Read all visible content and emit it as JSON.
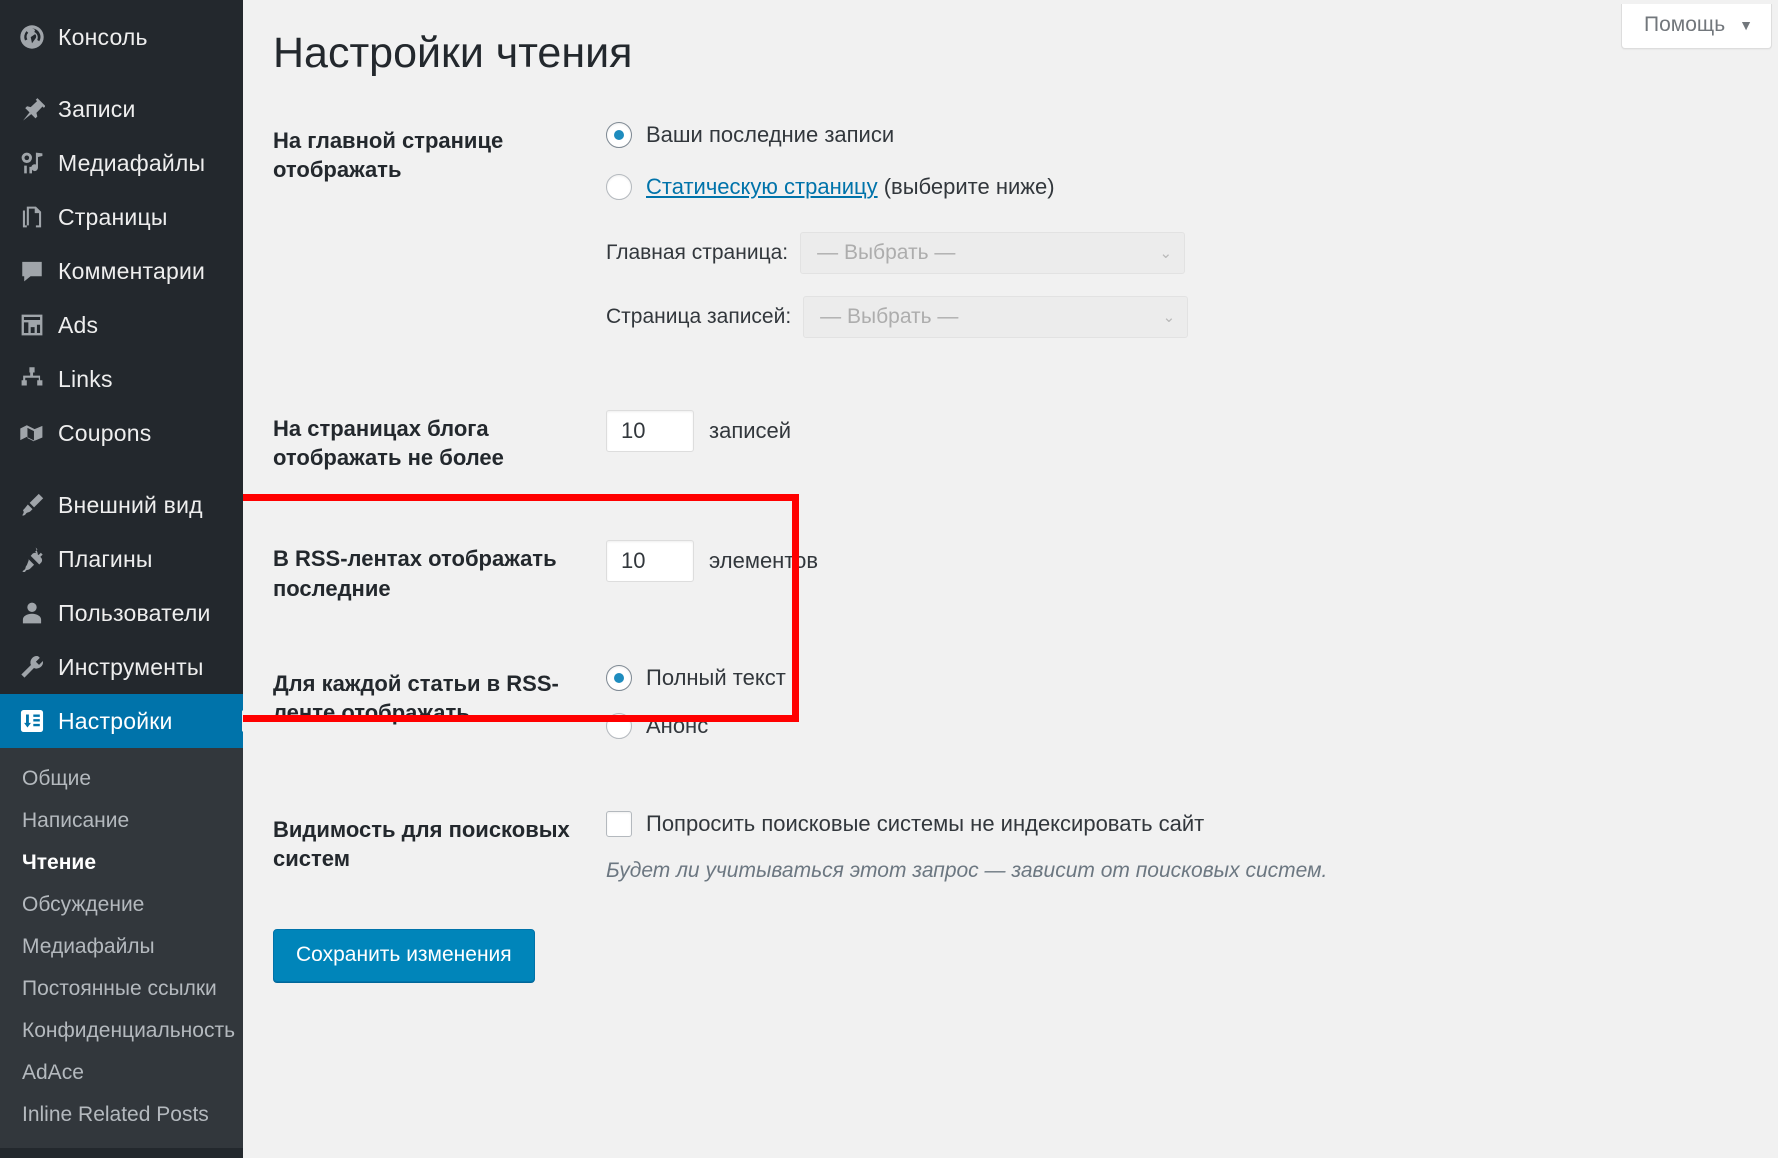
{
  "sidebar": {
    "items": [
      {
        "label": "Консоль",
        "icon": "dashboard-icon",
        "current": false,
        "gap": false
      },
      {
        "label": "Записи",
        "icon": "pin-icon",
        "current": false,
        "gap": true
      },
      {
        "label": "Медиафайлы",
        "icon": "media-icon",
        "current": false,
        "gap": false
      },
      {
        "label": "Страницы",
        "icon": "pages-icon",
        "current": false,
        "gap": false
      },
      {
        "label": "Комментарии",
        "icon": "comments-icon",
        "current": false,
        "gap": false
      },
      {
        "label": "Ads",
        "icon": "ads-icon",
        "current": false,
        "gap": false
      },
      {
        "label": "Links",
        "icon": "links-icon",
        "current": false,
        "gap": false
      },
      {
        "label": "Coupons",
        "icon": "coupons-icon",
        "current": false,
        "gap": false
      },
      {
        "label": "Внешний вид",
        "icon": "appearance-icon",
        "current": false,
        "gap": true
      },
      {
        "label": "Плагины",
        "icon": "plugins-icon",
        "current": false,
        "gap": false
      },
      {
        "label": "Пользователи",
        "icon": "users-icon",
        "current": false,
        "gap": false
      },
      {
        "label": "Инструменты",
        "icon": "tools-icon",
        "current": false,
        "gap": false
      },
      {
        "label": "Настройки",
        "icon": "settings-icon",
        "current": true,
        "gap": false
      }
    ],
    "submenu": [
      {
        "label": "Общие",
        "active": false
      },
      {
        "label": "Написание",
        "active": false
      },
      {
        "label": "Чтение",
        "active": true
      },
      {
        "label": "Обсуждение",
        "active": false
      },
      {
        "label": "Медиафайлы",
        "active": false
      },
      {
        "label": "Постоянные ссылки",
        "active": false
      },
      {
        "label": "Конфиденциальность",
        "active": false
      },
      {
        "label": "AdAce",
        "active": false
      },
      {
        "label": "Inline Related Posts",
        "active": false
      }
    ]
  },
  "header": {
    "help_label": "Помощь",
    "help_caret": "▼"
  },
  "page": {
    "title": "Настройки чтения"
  },
  "front_page": {
    "label": "На главной странице отображать",
    "option_latest": "Ваши последние записи",
    "option_static_link": "Статическую страницу",
    "option_static_rest": " (выберите ниже)",
    "homepage_label": "Главная страница:",
    "homepage_value": "— Выбрать —",
    "postspage_label": "Страница записей:",
    "postspage_value": "— Выбрать —",
    "chevron": "⌄"
  },
  "posts_per_page": {
    "label": "На страницах блога отображать не более",
    "value": "10",
    "suffix": "записей"
  },
  "rss": {
    "items_label": "В RSS-лентах отображать последние",
    "items_value": "10",
    "items_suffix": "элементов",
    "excerpt_label": "Для каждой статьи в RSS-ленте отображать",
    "option_full": "Полный текст",
    "option_summary": "Анонс",
    "highlight_color": "#ff0000"
  },
  "search_visibility": {
    "label": "Видимость для поисковых систем",
    "checkbox_label": "Попросить поисковые системы не индексировать сайт",
    "description": "Будет ли учитываться этот запрос — зависит от поисковых систем."
  },
  "footer": {
    "save_label": "Сохранить изменения"
  },
  "colors": {
    "sidebar_bg": "#23282d",
    "submenu_bg": "#32373c",
    "accent": "#0073aa",
    "button": "#0085ba",
    "link": "#0073aa"
  }
}
